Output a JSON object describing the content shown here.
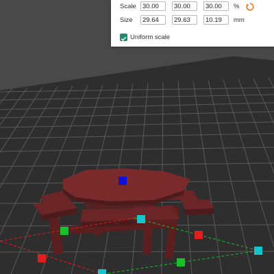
{
  "scale_panel": {
    "scale_label": "Scale",
    "scale_x": "30.00",
    "scale_y": "30.00",
    "scale_z": "30.00",
    "scale_unit": "%",
    "size_label": "Size",
    "size_x": "29.64",
    "size_y": "29.63",
    "size_z": "10.19",
    "size_unit": "mm",
    "uniform_label": "Uniform scale",
    "uniform_checked": true,
    "reset_icon": "reset-icon"
  },
  "viewport": {
    "model": "octagonal-picnic-table",
    "model_color": "#6b2526",
    "bed_color": "#2e2e2e",
    "grid_color": "#5a5a5a",
    "handle_colors": {
      "x": "#e01e1e",
      "y": "#16c12a",
      "z": "#1010d0",
      "corner": "#17c4cc"
    }
  }
}
